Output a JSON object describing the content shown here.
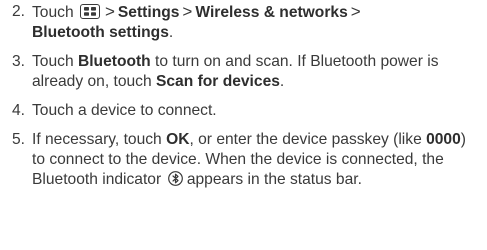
{
  "steps": [
    {
      "number": "2.",
      "touch": "Touch",
      "menu_key_icon": "menu-key-icon",
      "sep1": ">",
      "settings": "Settings",
      "sep2": ">",
      "wireless": "Wireless & networks",
      "sep3": ">",
      "bt_settings": "Bluetooth settings",
      "period": "."
    },
    {
      "number": "3.",
      "text_a": "Touch ",
      "bold_a": "Bluetooth",
      "text_b": " to turn on and scan. If Bluetooth power is already on, touch ",
      "bold_b": "Scan for devices",
      "text_c": "."
    },
    {
      "number": "4.",
      "text": "Touch a device to connect."
    },
    {
      "number": "5.",
      "text_a": "If necessary, touch ",
      "bold_a": "OK",
      "text_b": ", or enter the device passkey (like ",
      "bold_b": "0000",
      "text_c": ") to connect to the device. When the device is connected, the Bluetooth indicator ",
      "indicator_icon": "bluetooth-indicator-icon",
      "text_d": " appears in the status bar."
    }
  ]
}
